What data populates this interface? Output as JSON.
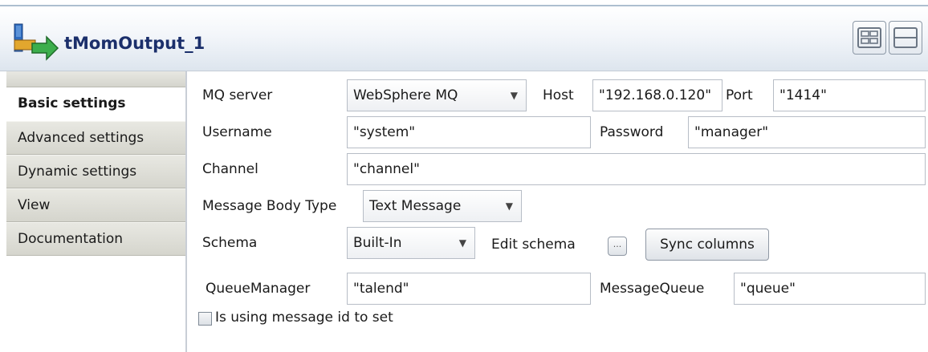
{
  "component": {
    "title": "tMomOutput_1",
    "icon": "mom-output-component-icon"
  },
  "toolbar": {
    "layout_icons": [
      "grid-layout-icon",
      "rows-layout-icon"
    ]
  },
  "tabs": [
    {
      "label": "Basic settings",
      "active": true
    },
    {
      "label": "Advanced settings",
      "active": false
    },
    {
      "label": "Dynamic settings",
      "active": false
    },
    {
      "label": "View",
      "active": false
    },
    {
      "label": "Documentation",
      "active": false
    }
  ],
  "form": {
    "mq_server": {
      "label": "MQ server",
      "value": "WebSphere MQ"
    },
    "host": {
      "label": "Host",
      "value": "\"192.168.0.120\""
    },
    "port": {
      "label": "Port",
      "value": "\"1414\""
    },
    "username": {
      "label": "Username",
      "value": "\"system\""
    },
    "password": {
      "label": "Password",
      "value": "\"manager\""
    },
    "channel": {
      "label": "Channel",
      "value": "\"channel\""
    },
    "message_body_type": {
      "label": "Message Body Type",
      "value": "Text Message"
    },
    "schema": {
      "label": "Schema",
      "value": "Built-In"
    },
    "edit_schema": {
      "label": "Edit schema",
      "button": "..."
    },
    "sync_columns": {
      "label": "Sync columns"
    },
    "queue_manager": {
      "label": "QueueManager",
      "value": "\"talend\""
    },
    "message_queue": {
      "label": "MessageQueue",
      "value": "\"queue\""
    },
    "use_message_id": {
      "label": "Is using message id to set",
      "checked": false
    }
  },
  "colors": {
    "title_text": "#1b2f6b",
    "tab_inactive": "#d8d8d0",
    "field_border": "#b7bdc6"
  }
}
